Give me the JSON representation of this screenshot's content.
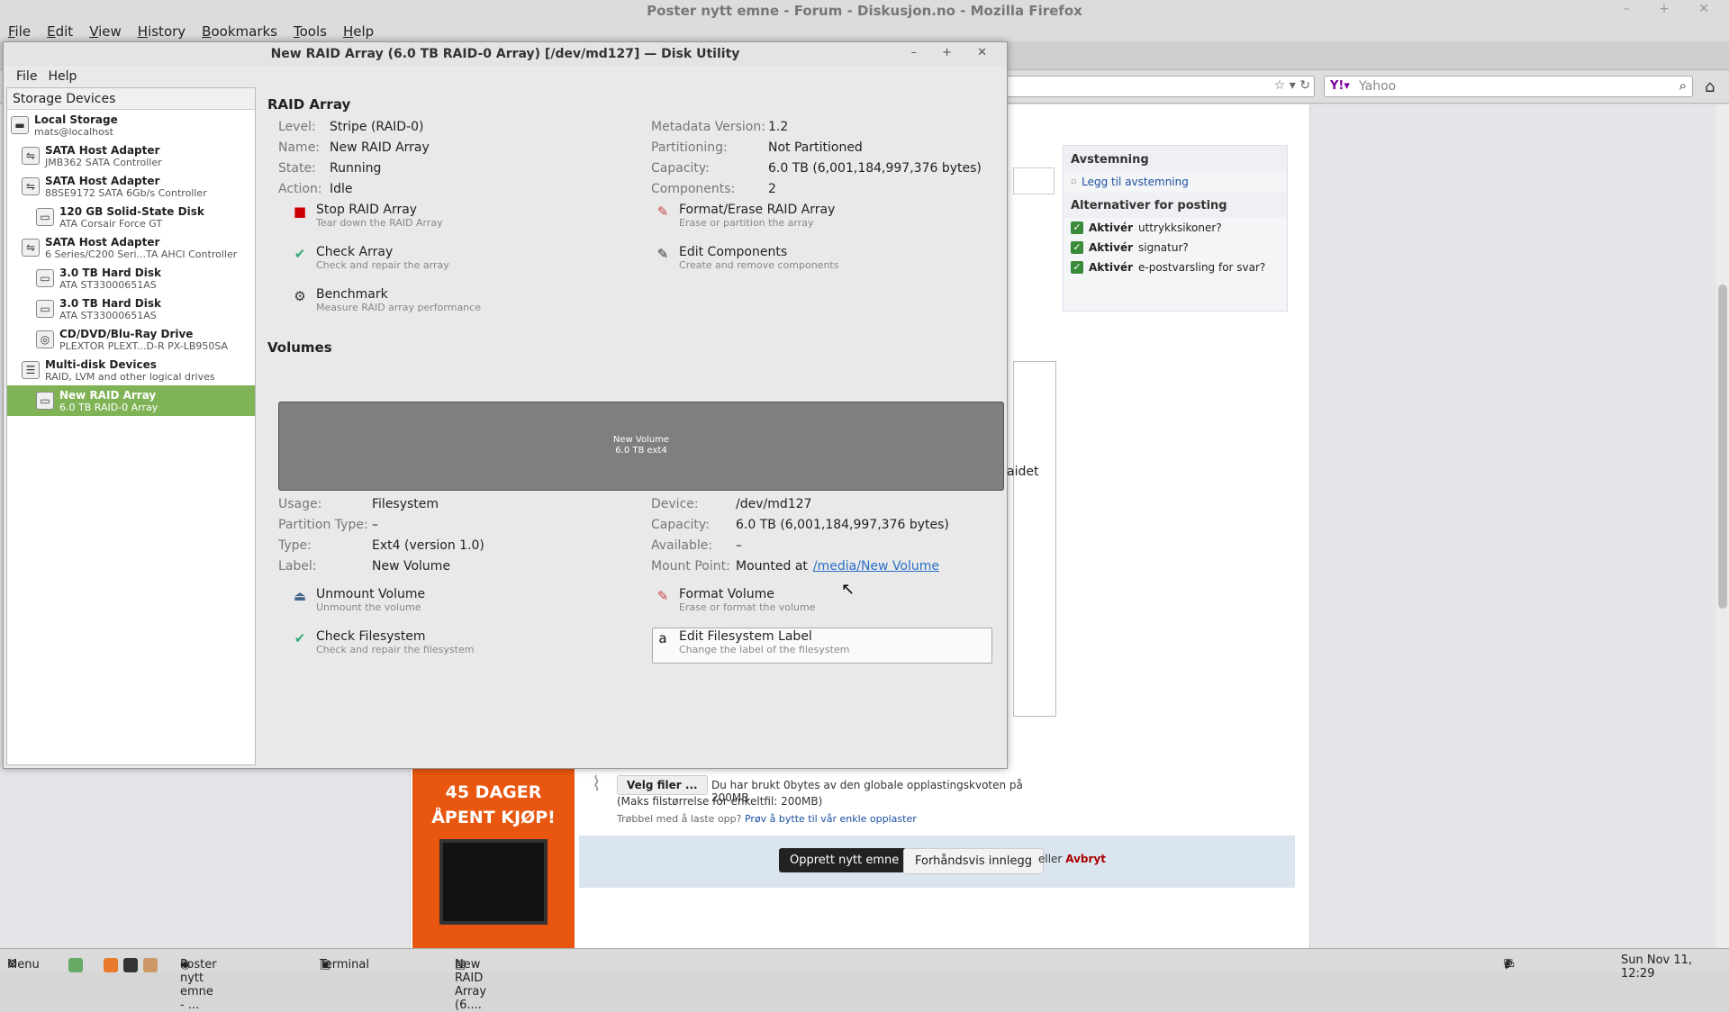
{
  "firefox": {
    "title": "Poster nytt emne - Forum - Diskusjon.no - Mozilla Firefox",
    "menu": [
      "File",
      "Edit",
      "View",
      "History",
      "Bookmarks",
      "Tools",
      "Help"
    ],
    "search_placeholder": "Yahoo"
  },
  "forum": {
    "poll_header": "Avstemning",
    "poll_link": "Legg til avstemning",
    "options_header": "Alternativer for posting",
    "options": [
      {
        "bold": "Aktivér",
        "rest": "uttrykksikoner?"
      },
      {
        "bold": "Aktivér",
        "rest": "signatur?"
      },
      {
        "bold": "Aktivér",
        "rest": "e-postvarsling for svar?"
      }
    ],
    "fragment_text": "aidet",
    "attach_button": "Velg filer ...",
    "attach_line1": "Du har brukt 0bytes av den globale opplastingskvoten på 200MB",
    "attach_line2": "(Maks filstørrelse for enkeltfil: 200MB)",
    "attach_trouble": "Trøbbel med å laste opp?",
    "attach_trouble_link": "Prøv å bytte til vår enkle opplaster",
    "create_button": "Opprett nytt emne",
    "preview_button": "Forhåndsvis innlegg",
    "or_text": "eller",
    "cancel_link": "Avbryt",
    "ad_text": "45 DAGER ÅPENT KJØP!"
  },
  "disk_utility": {
    "title": "New RAID Array (6.0 TB RAID-0 Array) [/dev/md127] — Disk Utility",
    "menu": [
      "File",
      "Help"
    ],
    "sidebar_header": "Storage Devices",
    "devices": [
      {
        "name": "Local Storage",
        "sub": "mats@localhost",
        "level": 0,
        "icon": "monitor-icon",
        "glyph": "▬"
      },
      {
        "name": "SATA Host Adapter",
        "sub": "JMB362 SATA Controller",
        "level": 1,
        "icon": "adapter-icon",
        "glyph": "⇋"
      },
      {
        "name": "SATA Host Adapter",
        "sub": "88SE9172 SATA 6Gb/s Controller",
        "level": 1,
        "icon": "adapter-icon",
        "glyph": "⇋"
      },
      {
        "name": "120 GB Solid-State Disk",
        "sub": "ATA Corsair Force GT",
        "level": 2,
        "icon": "disk-icon",
        "glyph": "▭"
      },
      {
        "name": "SATA Host Adapter",
        "sub": "6 Series/C200 Seri...TA AHCI Controller",
        "level": 1,
        "icon": "adapter-icon",
        "glyph": "⇋"
      },
      {
        "name": "3.0 TB Hard Disk",
        "sub": "ATA ST33000651AS",
        "level": 2,
        "icon": "disk-icon",
        "glyph": "▭"
      },
      {
        "name": "3.0 TB Hard Disk",
        "sub": "ATA ST33000651AS",
        "level": 2,
        "icon": "disk-icon",
        "glyph": "▭"
      },
      {
        "name": "CD/DVD/Blu-Ray Drive",
        "sub": "PLEXTOR PLEXT...D-R  PX-LB950SA",
        "level": 2,
        "icon": "optical-drive-icon",
        "glyph": "◎"
      },
      {
        "name": "Multi-disk Devices",
        "sub": "RAID, LVM and other logical drives",
        "level": 1,
        "icon": "multidisk-icon",
        "glyph": "☰"
      },
      {
        "name": "New RAID Array",
        "sub": "6.0 TB RAID-0 Array",
        "level": 2,
        "icon": "raid-icon",
        "glyph": "▭",
        "selected": true
      }
    ],
    "raid_header": "RAID Array",
    "raid_left": [
      {
        "k": "Level:",
        "v": "Stripe (RAID-0)"
      },
      {
        "k": "Name:",
        "v": "New RAID Array"
      },
      {
        "k": "State:",
        "v": "Running"
      },
      {
        "k": "Action:",
        "v": "Idle"
      }
    ],
    "raid_right": [
      {
        "k": "Metadata Version:",
        "v": "1.2"
      },
      {
        "k": "Partitioning:",
        "v": "Not Partitioned"
      },
      {
        "k": "Capacity:",
        "v": "6.0 TB (6,001,184,997,376 bytes)"
      },
      {
        "k": "Components:",
        "v": "2"
      }
    ],
    "raid_actions": [
      {
        "label": "Stop RAID Array",
        "desc": "Tear down the RAID Array",
        "icon": "stop-icon",
        "glyph": "■",
        "color": "#c00"
      },
      {
        "label": "Format/Erase RAID Array",
        "desc": "Erase or partition the array",
        "icon": "format-icon",
        "glyph": "✎",
        "color": "#c44"
      },
      {
        "label": "Check Array",
        "desc": "Check and repair the array",
        "icon": "check-icon",
        "glyph": "✔",
        "color": "#3a7"
      },
      {
        "label": "Edit Components",
        "desc": "Create and remove components",
        "icon": "edit-icon",
        "glyph": "✎",
        "color": "#333"
      },
      {
        "label": "Benchmark",
        "desc": "Measure RAID array performance",
        "icon": "gear-icon",
        "glyph": "⚙",
        "color": "#333"
      }
    ],
    "volumes_header": "Volumes",
    "volume_bar": {
      "name": "New Volume",
      "detail": "6.0 TB ext4"
    },
    "vol_left": [
      {
        "k": "Usage:",
        "v": "Filesystem"
      },
      {
        "k": "Partition Type:",
        "v": "–"
      },
      {
        "k": "Type:",
        "v": "Ext4 (version 1.0)"
      },
      {
        "k": "Label:",
        "v": "New Volume"
      }
    ],
    "vol_right": [
      {
        "k": "Device:",
        "v": "/dev/md127"
      },
      {
        "k": "Capacity:",
        "v": "6.0 TB (6,001,184,997,376 bytes)"
      },
      {
        "k": "Available:",
        "v": "–"
      },
      {
        "k": "Mount Point:",
        "v": "Mounted at",
        "link": "/media/New Volume"
      }
    ],
    "vol_actions": [
      {
        "label": "Unmount Volume",
        "desc": "Unmount the volume",
        "icon": "eject-icon",
        "glyph": "⏏",
        "color": "#468"
      },
      {
        "label": "Format Volume",
        "desc": "Erase or format the volume",
        "icon": "format-icon",
        "glyph": "✎",
        "color": "#c44"
      },
      {
        "label": "Check Filesystem",
        "desc": "Check and repair the filesystem",
        "icon": "check-icon",
        "glyph": "✔",
        "color": "#3a7"
      },
      {
        "label": "Edit Filesystem Label",
        "desc": "Change the label of the filesystem",
        "icon": "label-icon",
        "glyph": "a",
        "color": "#111"
      }
    ]
  },
  "taskbar": {
    "menu": "Menu",
    "windows": [
      "Poster nytt emne - ...",
      "Terminal",
      "New RAID Array (6...."
    ],
    "clock": "Sun Nov 11, 12:29"
  }
}
